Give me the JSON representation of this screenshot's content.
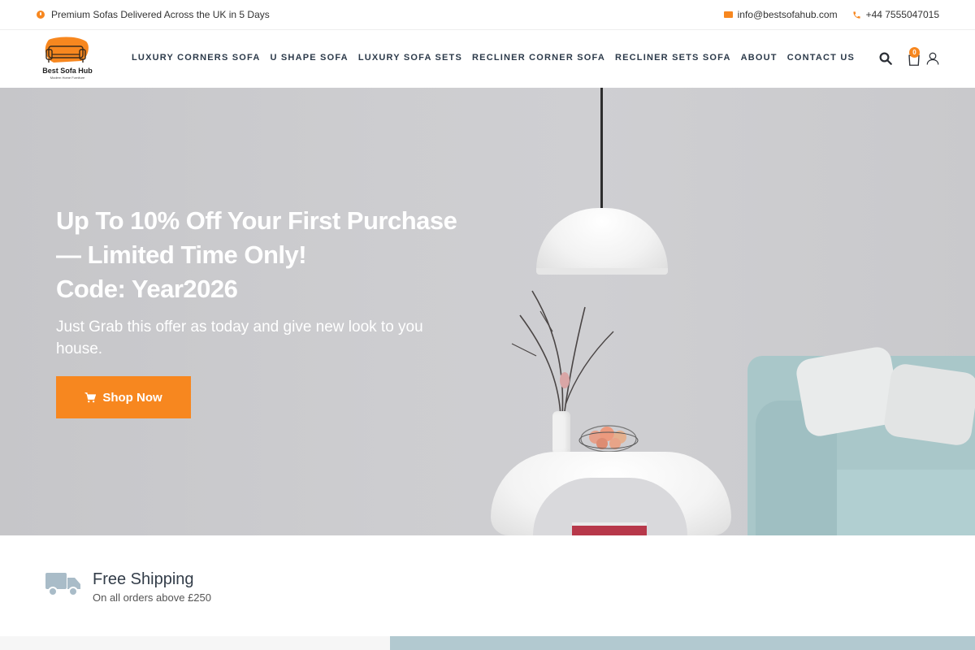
{
  "topbar": {
    "announcement": "Premium Sofas Delivered Across the UK in 5 Days",
    "email": "info@bestsofahub.com",
    "phone": "+44 7555047015"
  },
  "header": {
    "logo_title": "Best Sofa Hub",
    "logo_subtitle": "Modern Home Furniture",
    "nav": [
      "LUXURY CORNERS SOFA",
      "U SHAPE SOFA",
      "LUXURY SOFA SETS",
      "RECLINER CORNER SOFA",
      "RECLINER SETS SOFA",
      "ABOUT",
      "CONTACT US"
    ],
    "cart_count": "0"
  },
  "hero": {
    "title_line1": "Up To 10% Off Your First Purchase",
    "title_line2": "— Limited Time Only!",
    "title_line3": "Code: Year2026",
    "subtitle": "Just Grab this offer as today and give new look to you house.",
    "button_label": "Shop Now"
  },
  "features": {
    "title": "Free Shipping",
    "text": "On all orders above £250"
  },
  "colors": {
    "accent": "#f7871f",
    "nav_text": "#2c3a4a",
    "truck_icon": "#a9bcc8"
  },
  "icons": [
    "info-icon",
    "mail-icon",
    "phone-icon",
    "search-icon",
    "cart-icon",
    "user-icon",
    "truck-icon"
  ]
}
